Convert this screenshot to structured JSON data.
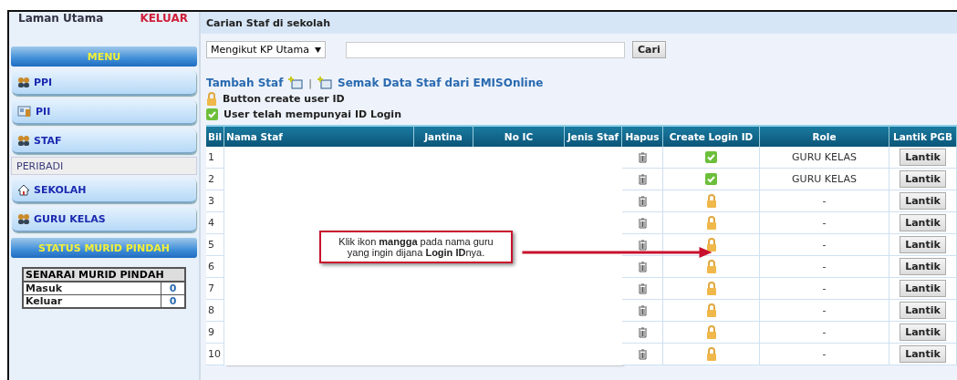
{
  "top_links": {
    "home": "Laman Utama",
    "logout": "KELUAR"
  },
  "sidebar": {
    "menu_title": "MENU",
    "items": [
      {
        "kind": "button",
        "label": "PPI"
      },
      {
        "kind": "button",
        "label": "PII"
      },
      {
        "kind": "button",
        "label": "STAF"
      },
      {
        "kind": "sub",
        "label": "PERIBADI"
      },
      {
        "kind": "button",
        "label": "SEKOLAH"
      },
      {
        "kind": "button",
        "label": "GURU KELAS"
      }
    ],
    "status_title": "STATUS MURID PINDAH",
    "transfer_table": {
      "title": "SENARAI MURID PINDAH",
      "rows": [
        {
          "label": "Masuk",
          "count": "0"
        },
        {
          "label": "Keluar",
          "count": "0"
        }
      ]
    }
  },
  "main": {
    "title": "Carian Staf di sekolah",
    "search": {
      "filter": "Mengikut KP Utama",
      "button": "Cari"
    },
    "links": [
      "Tambah Staf",
      "Semak Data Staf dari EMISOnline"
    ],
    "separator": "|",
    "legend": [
      {
        "text": "Button create user ID"
      },
      {
        "text": "User telah mempunyai ID Login"
      }
    ],
    "table": {
      "columns": [
        "Bil",
        "Nama Staf",
        "Jantina",
        "No IC",
        "Jenis Staf",
        "Hapus",
        "Create Login ID",
        "Role",
        "Lantik PGB"
      ],
      "rows": [
        {
          "bil": "1",
          "has_login": true,
          "role": "GURU KELAS",
          "action": "Lantik"
        },
        {
          "bil": "2",
          "has_login": true,
          "role": "GURU KELAS",
          "action": "Lantik"
        },
        {
          "bil": "3",
          "has_login": false,
          "role": "-",
          "action": "Lantik"
        },
        {
          "bil": "4",
          "has_login": false,
          "role": "-",
          "action": "Lantik"
        },
        {
          "bil": "5",
          "has_login": false,
          "role": "-",
          "action": "Lantik"
        },
        {
          "bil": "6",
          "has_login": false,
          "role": "-",
          "action": "Lantik"
        },
        {
          "bil": "7",
          "has_login": false,
          "role": "-",
          "action": "Lantik"
        },
        {
          "bil": "8",
          "has_login": false,
          "role": "-",
          "action": "Lantik"
        },
        {
          "bil": "9",
          "has_login": false,
          "role": "-",
          "action": "Lantik"
        },
        {
          "bil": "10",
          "has_login": false,
          "role": "-",
          "action": "Lantik"
        }
      ]
    },
    "callout": "Klik ikon **mangga** pada nama guru yang ingin dijana **Login ID**nya."
  }
}
